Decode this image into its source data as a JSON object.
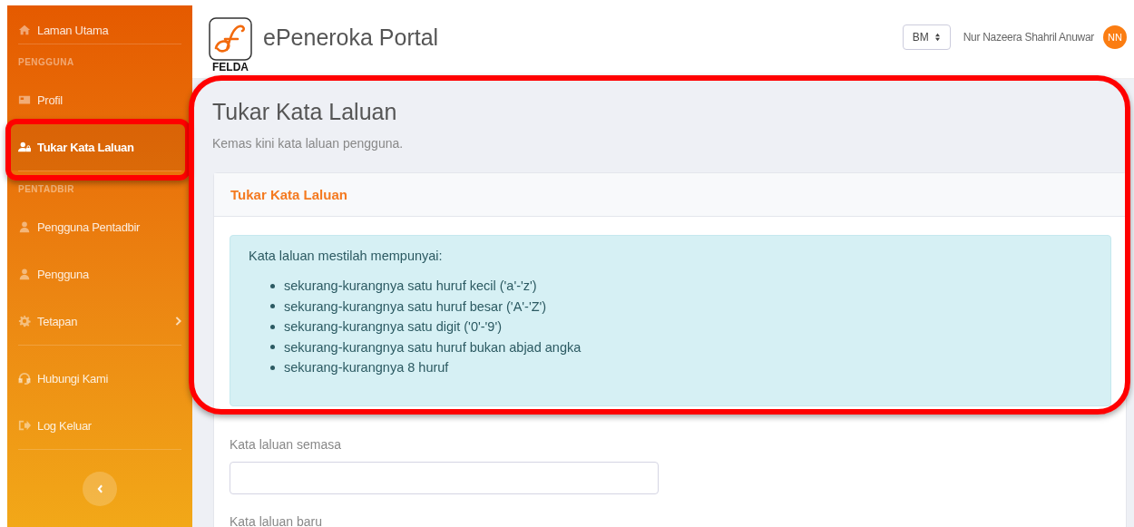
{
  "sidebar": {
    "groups": [
      {
        "items": [
          {
            "label": "Laman Utama",
            "selected": false,
            "has_submenu": false
          }
        ]
      },
      {
        "heading": "PENGGUNA",
        "items": [
          {
            "label": "Profil",
            "selected": false,
            "has_submenu": false
          },
          {
            "label": "Tukar Kata Laluan",
            "selected": true,
            "has_submenu": false
          }
        ]
      },
      {
        "heading": "PENTADBIR",
        "items": [
          {
            "label": "Pengguna Pentadbir",
            "selected": false,
            "has_submenu": false
          },
          {
            "label": "Pengguna",
            "selected": false,
            "has_submenu": false
          },
          {
            "label": "Tetapan",
            "selected": false,
            "has_submenu": true
          }
        ]
      },
      {
        "items": [
          {
            "label": "Hubungi Kami",
            "selected": false,
            "has_submenu": false
          },
          {
            "label": "Log Keluar",
            "selected": false,
            "has_submenu": false
          }
        ]
      }
    ]
  },
  "header": {
    "logo_text": "FELDA",
    "title": "ePeneroka Portal",
    "language": "BM",
    "user_name": "Nur Nazeera Shahril Anuwar",
    "user_initials": "NN"
  },
  "page": {
    "title": "Tukar Kata Laluan",
    "subtitle": "Kemas kini kata laluan pengguna."
  },
  "card": {
    "title": "Tukar Kata Laluan",
    "notice": {
      "intro": "Kata laluan mestilah mempunyai:",
      "rules": [
        "sekurang-kurangnya satu huruf kecil ('a'-'z')",
        "sekurang-kurangnya satu huruf besar ('A'-'Z')",
        "sekurang-kurangnya satu digit ('0'-'9')",
        "sekurang-kurangnya satu huruf bukan abjad angka",
        "sekurang-kurangnya 8 huruf"
      ]
    },
    "fields": [
      {
        "label": "Kata laluan semasa"
      }
    ],
    "cut_off_field_label": "Kata laluan baru"
  }
}
